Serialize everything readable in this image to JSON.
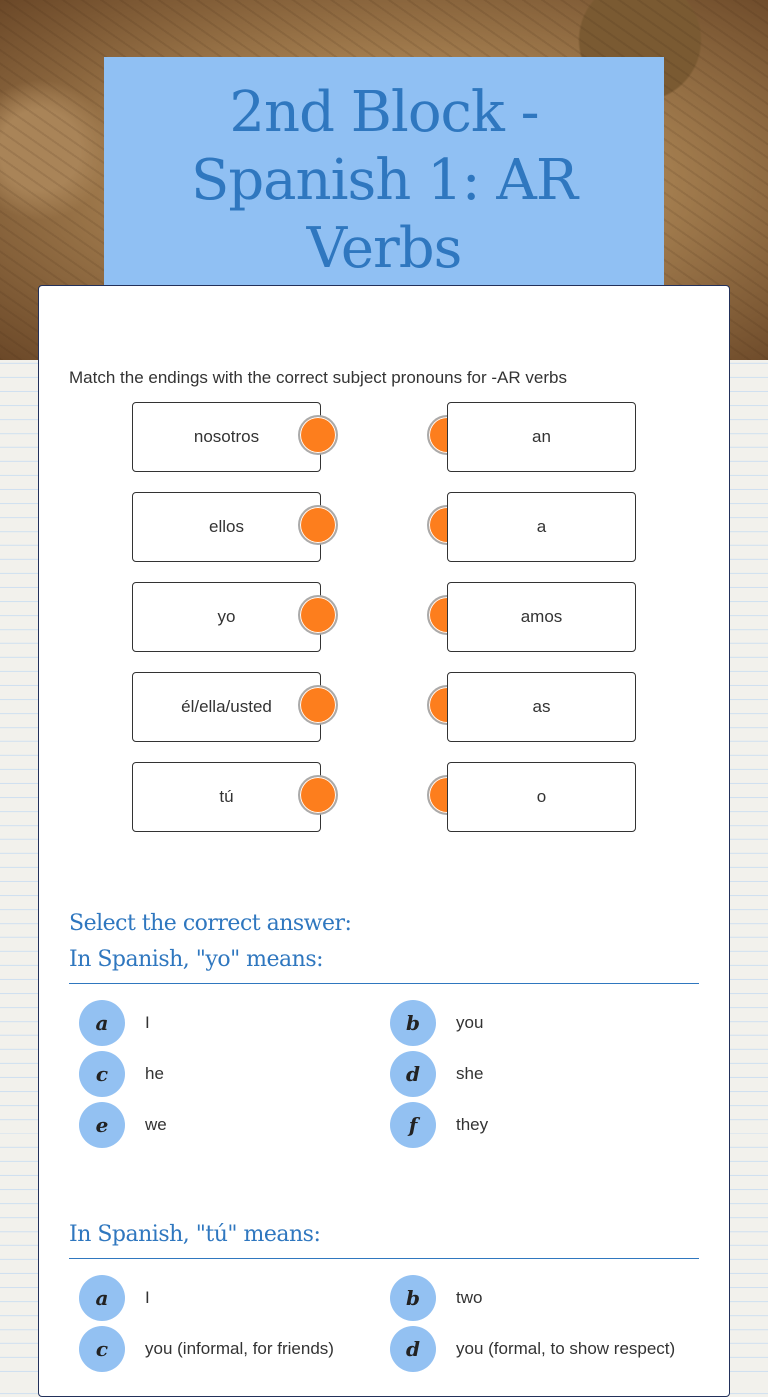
{
  "header": {
    "title": "2nd Block - Spanish 1: AR Verbs"
  },
  "matching": {
    "instruction": "Match the endings with the correct subject pronouns for -AR verbs",
    "left": [
      "nosotros",
      "ellos",
      "yo",
      "él/ella/usted",
      "tú"
    ],
    "right": [
      "an",
      "a",
      "amos",
      "as",
      "o"
    ],
    "dot_color": "#fd7e1d"
  },
  "question1": {
    "prompt_line1": "Select the correct answer:",
    "prompt_line2": "In Spanish, \"yo\" means:",
    "options": [
      {
        "letter": "a",
        "text": "I"
      },
      {
        "letter": "b",
        "text": "you"
      },
      {
        "letter": "c",
        "text": "he"
      },
      {
        "letter": "d",
        "text": "she"
      },
      {
        "letter": "e",
        "text": "we"
      },
      {
        "letter": "f",
        "text": "they"
      }
    ]
  },
  "question2": {
    "prompt": "In Spanish, \"tú\" means:",
    "options": [
      {
        "letter": "a",
        "text": "I"
      },
      {
        "letter": "b",
        "text": "two"
      },
      {
        "letter": "c",
        "text": "you (informal, for friends)"
      },
      {
        "letter": "d",
        "text": "you (formal, to show respect)"
      }
    ]
  },
  "colors": {
    "accent": "#2f77bf",
    "title_bg": "#90c0f3",
    "bubble": "#93c1f2"
  }
}
